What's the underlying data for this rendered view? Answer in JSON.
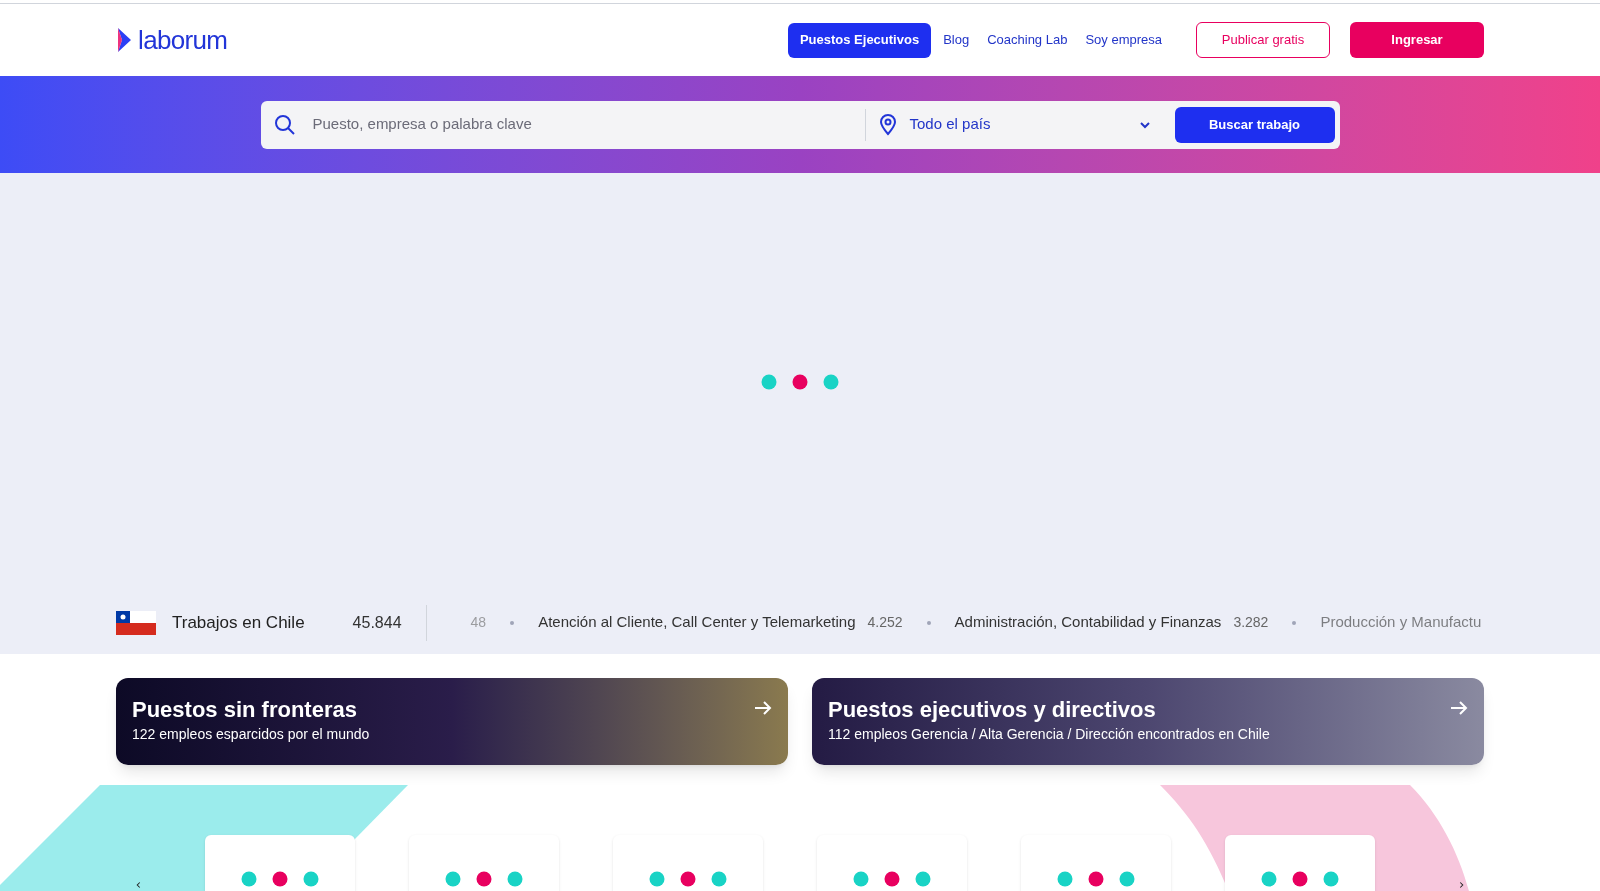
{
  "header": {
    "logo": "laborum",
    "nav": [
      {
        "label": "Puestos Ejecutivos",
        "selected": true
      },
      {
        "label": "Blog",
        "selected": false
      },
      {
        "label": "Coaching Lab",
        "selected": false
      },
      {
        "label": "Soy empresa",
        "selected": false
      }
    ],
    "buttons": [
      {
        "label": "Publicar gratis",
        "kind": "outline"
      },
      {
        "label": "Ingresar",
        "kind": "solid"
      }
    ]
  },
  "search": {
    "placeholder": "Puesto, empresa o palabra clave",
    "location": "Todo el país",
    "button": "Buscar trabajo"
  },
  "ticker": {
    "country": "Trabajos en Chile",
    "total": "45.844",
    "items": [
      {
        "count": "48",
        "faded": true
      },
      {
        "name": "Atención al Cliente, Call Center y Telemarketing",
        "count": "4.252",
        "faded": false
      },
      {
        "name": "Administración, Contabilidad y Finanzas",
        "count": "3.282",
        "faded": false
      },
      {
        "name": "Producción y Manufactu",
        "faded": true
      }
    ]
  },
  "promos": [
    {
      "title": "Puestos sin fronteras",
      "subtitle": "122 empleos esparcidos por el mundo",
      "kind": "map"
    },
    {
      "title": "Puestos ejecutivos y directivos",
      "subtitle": "112 empleos Gerencia / Alta Gerencia / Dirección encontrados en Chile",
      "kind": "office"
    }
  ]
}
